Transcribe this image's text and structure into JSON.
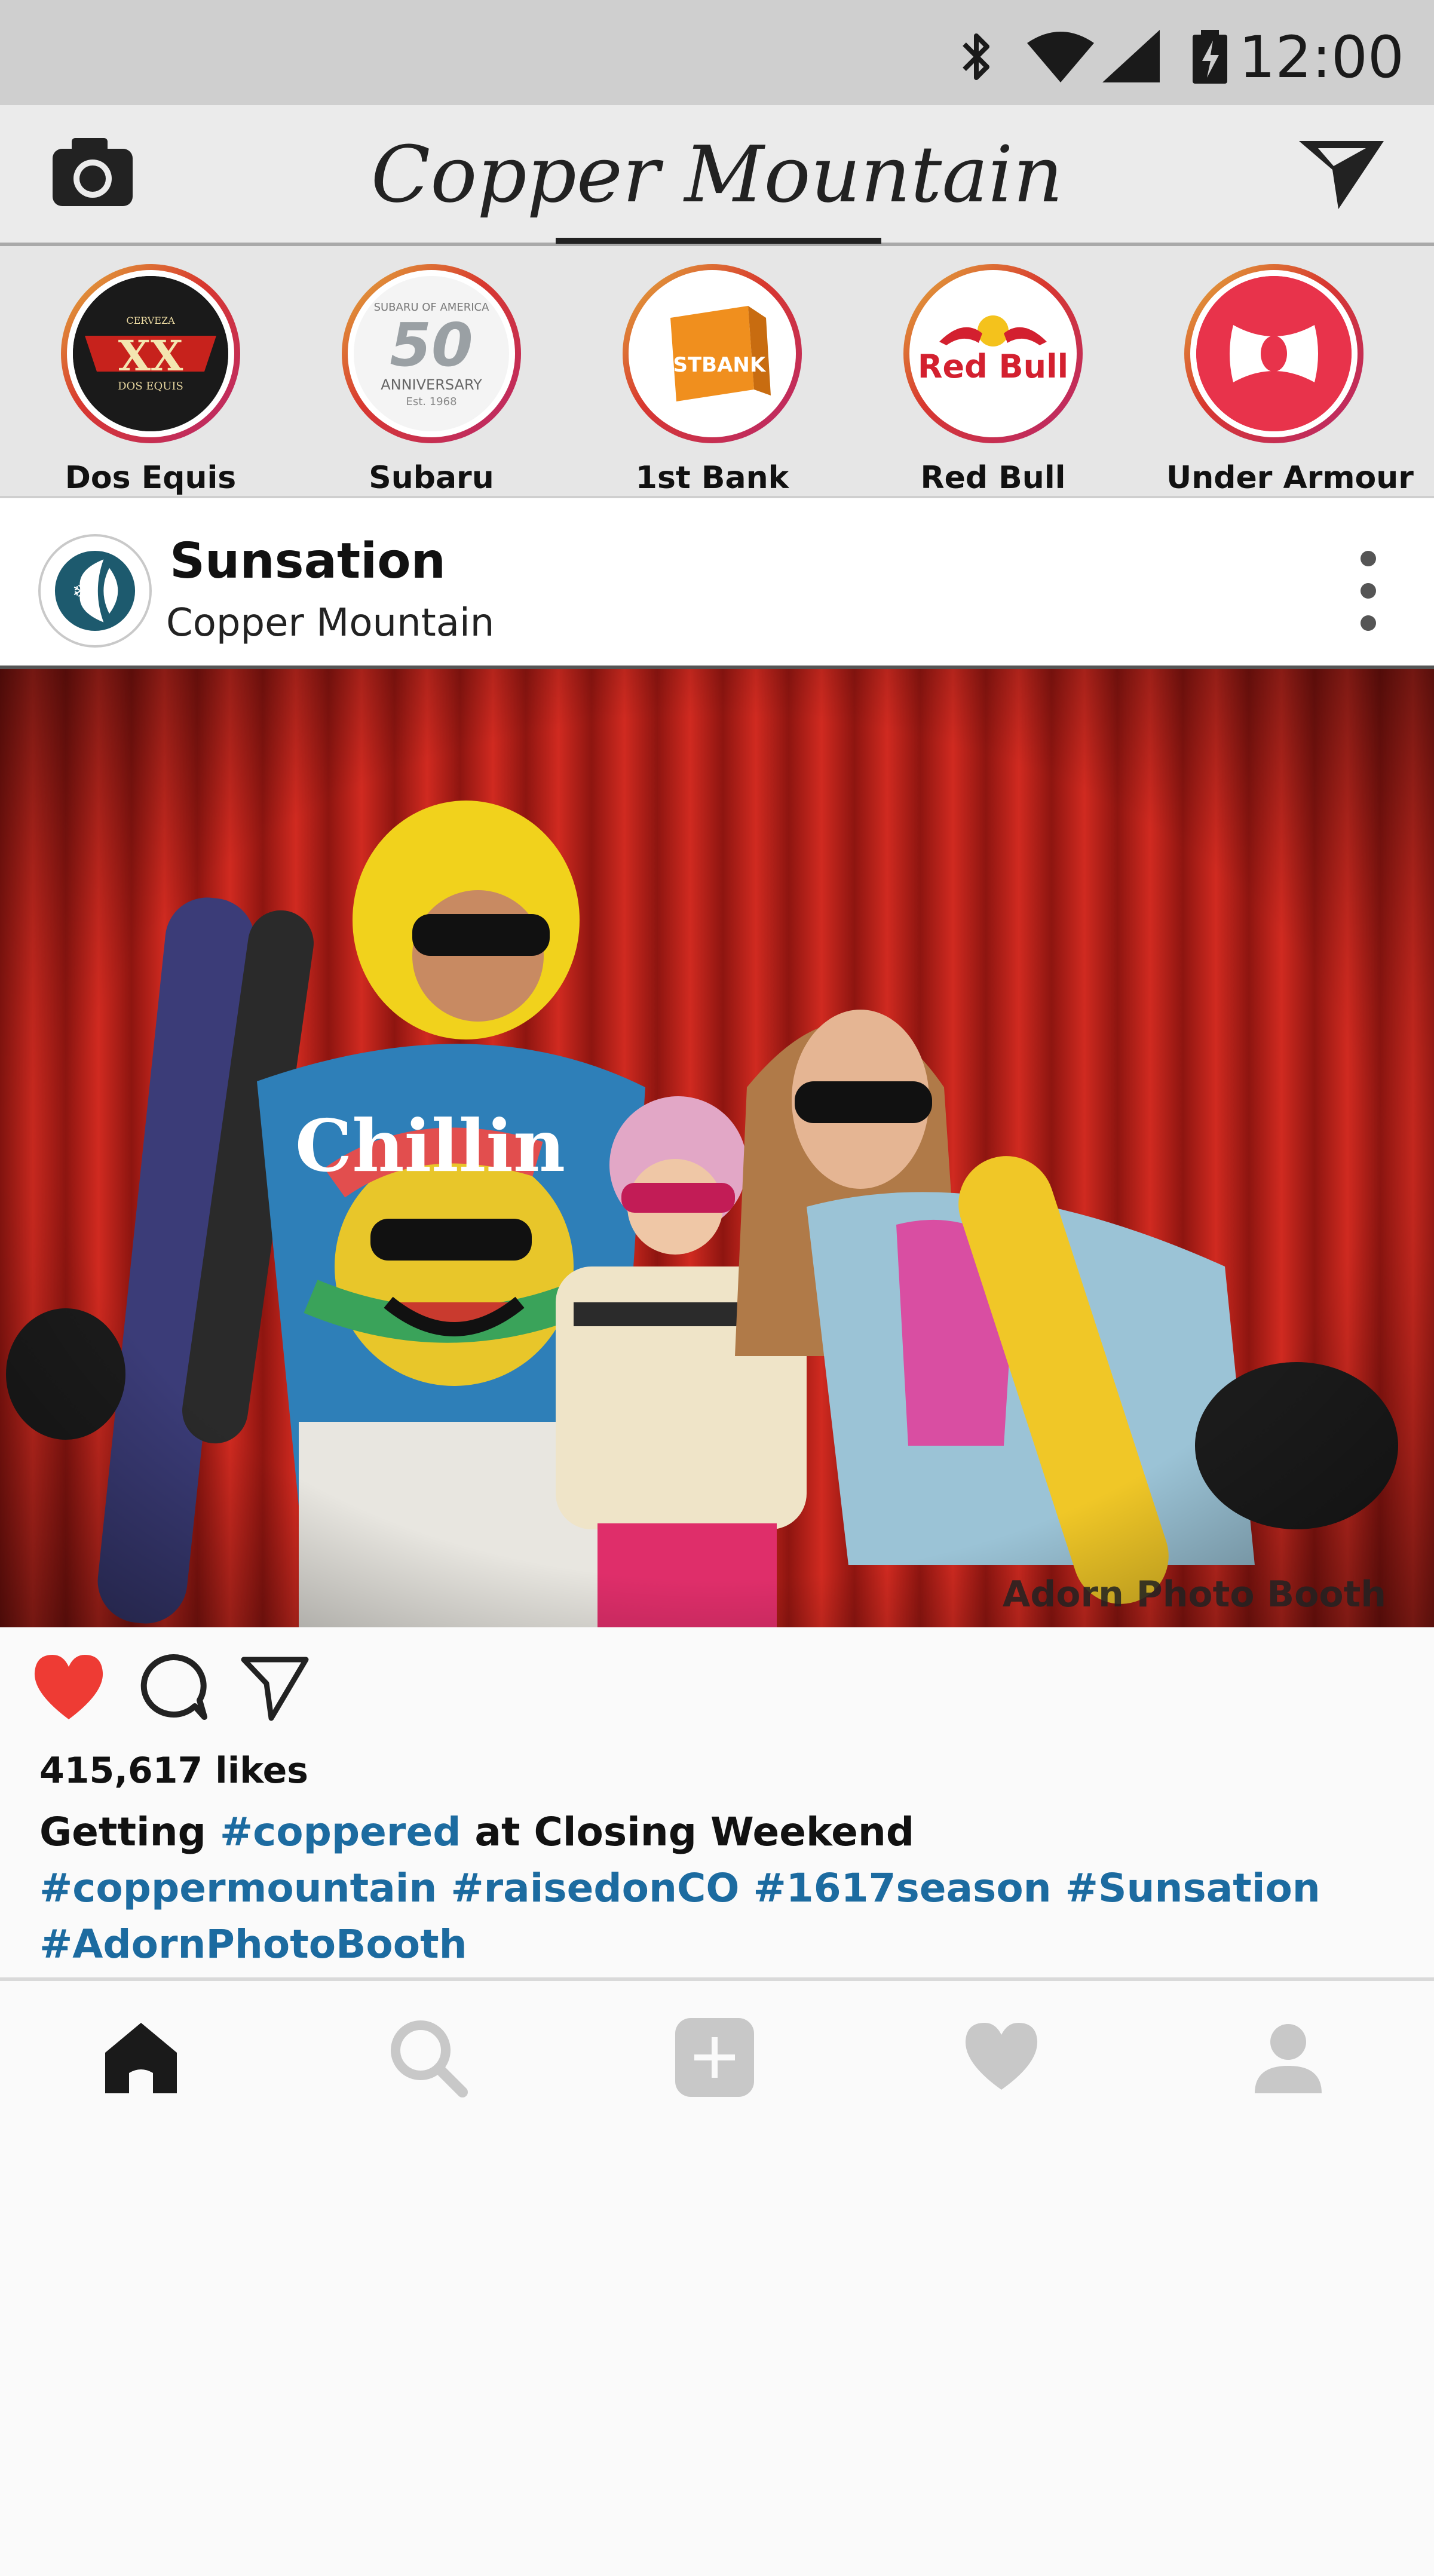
{
  "status_bar": {
    "time": "12:00",
    "icons": [
      "bluetooth-icon",
      "wifi-icon",
      "signal-icon",
      "battery-charging-icon"
    ]
  },
  "header": {
    "title": "Copper Mountain",
    "left_icon": "camera-icon",
    "right_icon": "send-icon"
  },
  "stories": [
    {
      "label": "Dos Equis",
      "logo": "dos-equis-logo"
    },
    {
      "label": "Subaru",
      "logo": "subaru-50th-logo"
    },
    {
      "label": "1st Bank",
      "logo": "1st-bank-logo"
    },
    {
      "label": "Red Bull",
      "logo": "red-bull-logo"
    },
    {
      "label": "Under Armour",
      "logo": "under-armour-logo"
    }
  ],
  "post": {
    "username": "Sunsation",
    "location": "Copper Mountain",
    "photo_watermark": "Adorn Photo Booth",
    "likes": "415,617 likes",
    "caption": {
      "part1": "Getting ",
      "tag1": "#coppered",
      "part2": " at Closing Weekend",
      "tags_line2": "#coppermountain #raisedonCO #1617season #Sunsation",
      "tags_line3": "#AdornPhotoBooth"
    },
    "liked": true
  },
  "colors": {
    "heart": "#ee3b34",
    "hashtag": "#1c6ba0",
    "curtain": "#c4201a",
    "status_bar": "#cfcfcf"
  },
  "nav": [
    "home-icon",
    "search-icon",
    "add-post-icon",
    "activity-heart-icon",
    "profile-icon"
  ]
}
